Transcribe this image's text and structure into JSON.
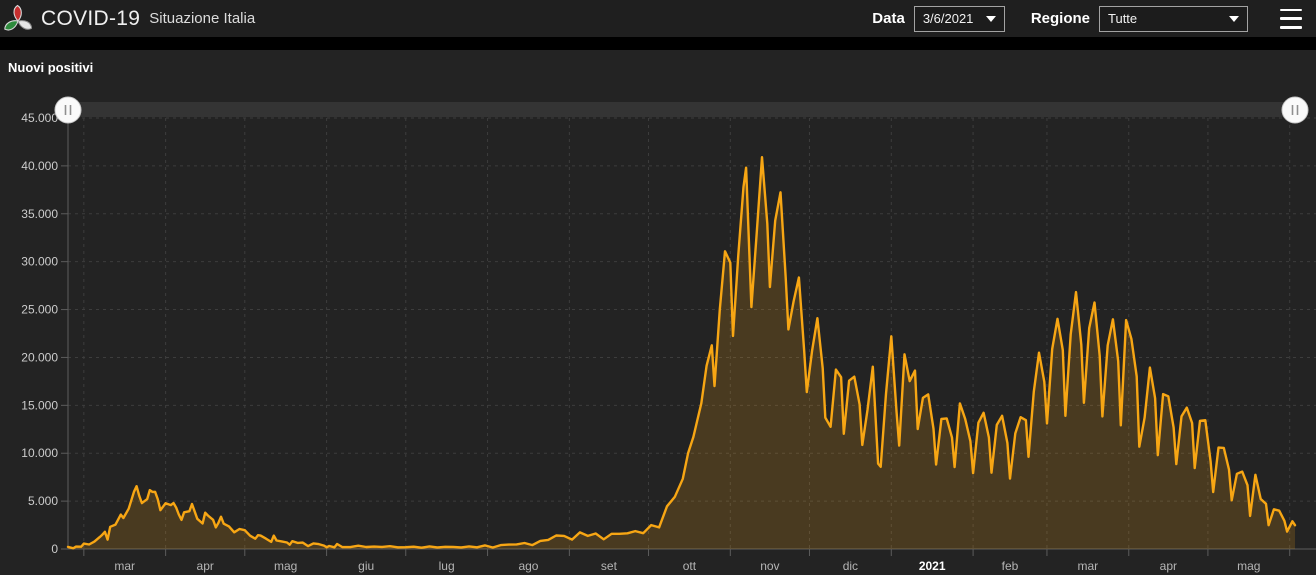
{
  "header": {
    "title": "COVID-19",
    "subtitle": "Situazione Italia",
    "date_label": "Data",
    "date_value": "3/6/2021",
    "region_label": "Regione",
    "region_value": "Tutte"
  },
  "panel": {
    "title": "Nuovi positivi"
  },
  "colors": {
    "accent": "#f7a614",
    "line": "#f7a614",
    "area_fill": "rgba(247,166,20,0.18)",
    "chart_background": "#232323",
    "header_background": "#1f1f1f",
    "grid": "#3d3d3d",
    "axis": "#5c5c5c",
    "y_tick_text": "#cccccc",
    "x_tick_text": "#b5b5b5",
    "x_tick_text_bold": "#ffffff",
    "slider_track": "#343434",
    "slider_handle": "#fafafa"
  },
  "chart_data": {
    "type": "area",
    "title": "Nuovi positivi",
    "legend": "none",
    "grid": "dashed",
    "x_domain_days": [
      0,
      465
    ],
    "x_ticks_days": [
      6,
      37,
      67,
      98,
      128,
      159,
      190,
      220,
      251,
      281,
      312,
      343,
      371,
      402,
      432,
      463
    ],
    "x_tick_labels": [
      "mar",
      "apr",
      "mag",
      "giu",
      "lug",
      "ago",
      "set",
      "ott",
      "nov",
      "dic",
      "2021",
      "feb",
      "mar",
      "apr",
      "mag"
    ],
    "x_bold_label_index": 10,
    "y_min": 0,
    "y_max": 45000,
    "y_step": 5000,
    "y_tick_labels": [
      "0",
      "5.000",
      "10.000",
      "15.000",
      "20.000",
      "25.000",
      "30.000",
      "35.000",
      "40.000",
      "45.000"
    ],
    "series": [
      {
        "name": "Nuovi positivi",
        "points": [
          [
            0,
            221
          ],
          [
            2,
            78
          ],
          [
            3,
            250
          ],
          [
            5,
            240
          ],
          [
            6,
            566
          ],
          [
            8,
            466
          ],
          [
            10,
            769
          ],
          [
            12,
            1247
          ],
          [
            13,
            1492
          ],
          [
            14,
            1797
          ],
          [
            15,
            977
          ],
          [
            16,
            2313
          ],
          [
            18,
            2547
          ],
          [
            20,
            3590
          ],
          [
            21,
            3233
          ],
          [
            23,
            4207
          ],
          [
            25,
            5986
          ],
          [
            26,
            6557
          ],
          [
            27,
            5560
          ],
          [
            28,
            4789
          ],
          [
            30,
            5210
          ],
          [
            31,
            6153
          ],
          [
            32,
            5959
          ],
          [
            33,
            5974
          ],
          [
            34,
            5217
          ],
          [
            35,
            4050
          ],
          [
            37,
            4782
          ],
          [
            39,
            4585
          ],
          [
            40,
            4805
          ],
          [
            41,
            4316
          ],
          [
            42,
            3599
          ],
          [
            43,
            3039
          ],
          [
            44,
            3836
          ],
          [
            46,
            3951
          ],
          [
            47,
            4694
          ],
          [
            49,
            3153
          ],
          [
            51,
            2667
          ],
          [
            52,
            3786
          ],
          [
            53,
            3493
          ],
          [
            55,
            3047
          ],
          [
            56,
            2256
          ],
          [
            57,
            2729
          ],
          [
            58,
            3370
          ],
          [
            59,
            2646
          ],
          [
            61,
            2357
          ],
          [
            63,
            1739
          ],
          [
            65,
            2086
          ],
          [
            67,
            1965
          ],
          [
            69,
            1389
          ],
          [
            71,
            1075
          ],
          [
            72,
            1444
          ],
          [
            73,
            1401
          ],
          [
            75,
            1083
          ],
          [
            77,
            744
          ],
          [
            78,
            1402
          ],
          [
            79,
            888
          ],
          [
            81,
            789
          ],
          [
            83,
            675
          ],
          [
            84,
            451
          ],
          [
            85,
            813
          ],
          [
            87,
            642
          ],
          [
            89,
            669
          ],
          [
            91,
            300
          ],
          [
            93,
            584
          ],
          [
            95,
            516
          ],
          [
            97,
            355
          ],
          [
            98,
            178
          ],
          [
            99,
            318
          ],
          [
            101,
            177
          ],
          [
            102,
            518
          ],
          [
            104,
            197
          ],
          [
            107,
            202
          ],
          [
            110,
            346
          ],
          [
            113,
            210
          ],
          [
            116,
            251
          ],
          [
            119,
            218
          ],
          [
            122,
            296
          ],
          [
            125,
            174
          ],
          [
            128,
            187
          ],
          [
            131,
            235
          ],
          [
            134,
            138
          ],
          [
            137,
            276
          ],
          [
            140,
            169
          ],
          [
            143,
            230
          ],
          [
            146,
            219
          ],
          [
            149,
            165
          ],
          [
            152,
            274
          ],
          [
            155,
            181
          ],
          [
            158,
            379
          ],
          [
            161,
            159
          ],
          [
            164,
            402
          ],
          [
            167,
            463
          ],
          [
            170,
            481
          ],
          [
            173,
            629
          ],
          [
            176,
            403
          ],
          [
            179,
            845
          ],
          [
            182,
            953
          ],
          [
            185,
            1411
          ],
          [
            188,
            1365
          ],
          [
            191,
            978
          ],
          [
            194,
            1733
          ],
          [
            197,
            1370
          ],
          [
            200,
            1616
          ],
          [
            203,
            1008
          ],
          [
            206,
            1585
          ],
          [
            209,
            1587
          ],
          [
            212,
            1640
          ],
          [
            215,
            1869
          ],
          [
            218,
            1648
          ],
          [
            221,
            2499
          ],
          [
            224,
            2257
          ],
          [
            227,
            4458
          ],
          [
            230,
            5456
          ],
          [
            233,
            7332
          ],
          [
            235,
            10010
          ],
          [
            237,
            11705
          ],
          [
            240,
            15199
          ],
          [
            242,
            19143
          ],
          [
            244,
            21273
          ],
          [
            245,
            17012
          ],
          [
            247,
            24991
          ],
          [
            249,
            31084
          ],
          [
            251,
            29907
          ],
          [
            252,
            22253
          ],
          [
            254,
            30550
          ],
          [
            256,
            37809
          ],
          [
            257,
            39811
          ],
          [
            259,
            25271
          ],
          [
            261,
            32961
          ],
          [
            263,
            40902
          ],
          [
            265,
            33979
          ],
          [
            266,
            27354
          ],
          [
            268,
            34282
          ],
          [
            270,
            37242
          ],
          [
            272,
            28337
          ],
          [
            273,
            22930
          ],
          [
            275,
            25853
          ],
          [
            277,
            28352
          ],
          [
            279,
            20648
          ],
          [
            280,
            16377
          ],
          [
            282,
            20709
          ],
          [
            284,
            24099
          ],
          [
            286,
            18887
          ],
          [
            287,
            13720
          ],
          [
            289,
            12756
          ],
          [
            291,
            18727
          ],
          [
            293,
            17938
          ],
          [
            294,
            12030
          ],
          [
            296,
            17572
          ],
          [
            298,
            17992
          ],
          [
            300,
            15104
          ],
          [
            301,
            10872
          ],
          [
            303,
            14522
          ],
          [
            305,
            19037
          ],
          [
            307,
            8913
          ],
          [
            308,
            8585
          ],
          [
            310,
            16202
          ],
          [
            312,
            22211
          ],
          [
            314,
            14245
          ],
          [
            315,
            10800
          ],
          [
            317,
            20331
          ],
          [
            319,
            17533
          ],
          [
            321,
            18627
          ],
          [
            322,
            12532
          ],
          [
            324,
            15774
          ],
          [
            326,
            16146
          ],
          [
            328,
            12545
          ],
          [
            329,
            8824
          ],
          [
            331,
            13571
          ],
          [
            333,
            13633
          ],
          [
            335,
            11629
          ],
          [
            336,
            8561
          ],
          [
            338,
            15204
          ],
          [
            340,
            13574
          ],
          [
            342,
            11252
          ],
          [
            343,
            7925
          ],
          [
            345,
            13189
          ],
          [
            347,
            14218
          ],
          [
            349,
            11641
          ],
          [
            350,
            7970
          ],
          [
            352,
            12956
          ],
          [
            354,
            13908
          ],
          [
            356,
            11068
          ],
          [
            357,
            7351
          ],
          [
            359,
            12074
          ],
          [
            361,
            13762
          ],
          [
            363,
            13452
          ],
          [
            364,
            9630
          ],
          [
            366,
            16424
          ],
          [
            368,
            20499
          ],
          [
            370,
            17455
          ],
          [
            371,
            13114
          ],
          [
            373,
            20884
          ],
          [
            375,
            24036
          ],
          [
            377,
            20765
          ],
          [
            378,
            13902
          ],
          [
            380,
            22409
          ],
          [
            382,
            26824
          ],
          [
            384,
            21315
          ],
          [
            385,
            15267
          ],
          [
            387,
            23059
          ],
          [
            389,
            25735
          ],
          [
            391,
            20159
          ],
          [
            392,
            13846
          ],
          [
            394,
            21267
          ],
          [
            396,
            23987
          ],
          [
            398,
            19611
          ],
          [
            399,
            12916
          ],
          [
            401,
            23904
          ],
          [
            403,
            21932
          ],
          [
            405,
            18025
          ],
          [
            406,
            10680
          ],
          [
            408,
            13708
          ],
          [
            410,
            18938
          ],
          [
            412,
            15746
          ],
          [
            413,
            9789
          ],
          [
            415,
            16168
          ],
          [
            417,
            15943
          ],
          [
            419,
            12694
          ],
          [
            420,
            8864
          ],
          [
            422,
            13844
          ],
          [
            424,
            14761
          ],
          [
            426,
            13158
          ],
          [
            427,
            8444
          ],
          [
            429,
            13385
          ],
          [
            431,
            13446
          ],
          [
            433,
            9148
          ],
          [
            434,
            5948
          ],
          [
            436,
            10585
          ],
          [
            438,
            10554
          ],
          [
            440,
            8292
          ],
          [
            441,
            5080
          ],
          [
            443,
            7852
          ],
          [
            445,
            8085
          ],
          [
            447,
            6659
          ],
          [
            448,
            3455
          ],
          [
            450,
            7743
          ],
          [
            452,
            5218
          ],
          [
            454,
            4717
          ],
          [
            455,
            2490
          ],
          [
            457,
            4147
          ],
          [
            459,
            3995
          ],
          [
            461,
            2949
          ],
          [
            462,
            1820
          ],
          [
            464,
            2897
          ],
          [
            465,
            2483
          ]
        ]
      }
    ]
  }
}
